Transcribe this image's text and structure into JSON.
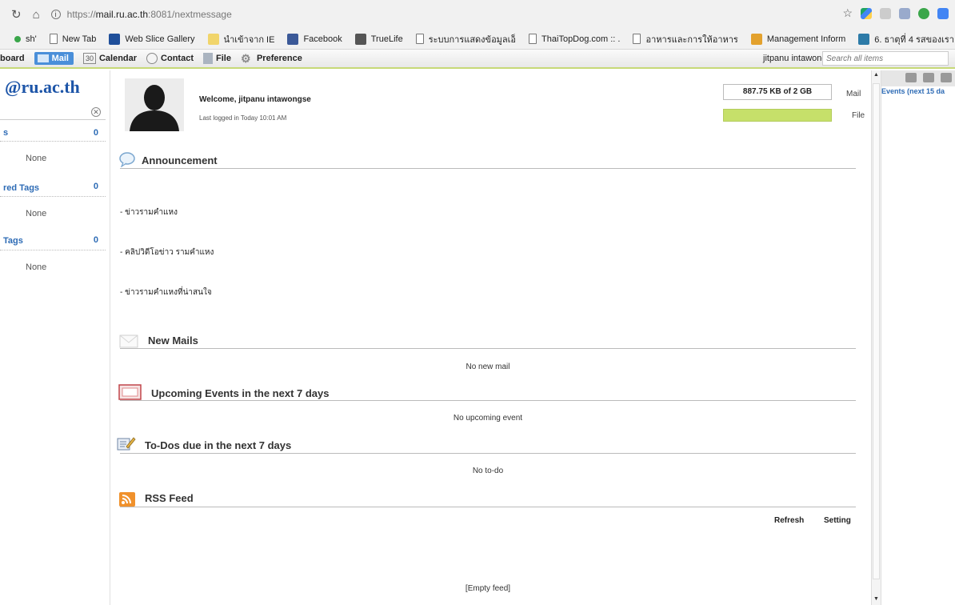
{
  "browser": {
    "url_prefix": "https://",
    "url_host": "mail.ru.ac.th",
    "url_path": ":8081/nextmessage"
  },
  "bookmarks": [
    {
      "label": "sh'",
      "icon": "green-dot-icon",
      "color": "#3aa64a"
    },
    {
      "label": "New Tab",
      "icon": "page-icon"
    },
    {
      "label": "Web Slice Gallery",
      "icon": "web-slice-icon",
      "color": "#1f4f9a"
    },
    {
      "label": "นำเข้าจาก IE",
      "icon": "folder-icon",
      "color": "#f1d56b"
    },
    {
      "label": "Facebook",
      "icon": "facebook-icon",
      "color": "#3b5998"
    },
    {
      "label": "TrueLife",
      "icon": "truelife-icon",
      "color": "#555555"
    },
    {
      "label": "ระบบการแสดงข้อมูลเอ็",
      "icon": "page-icon"
    },
    {
      "label": "ThaiTopDog.com :: .",
      "icon": "page-icon"
    },
    {
      "label": "อาหารและการให้อาหาร",
      "icon": "page-icon"
    },
    {
      "label": "Management Inform",
      "icon": "mis-icon",
      "color": "#e3a12d"
    },
    {
      "label": "6. ธาตุที่ 4 รสของเรา",
      "icon": "wordpress-icon",
      "color": "#2d7ba8"
    }
  ],
  "menubar": {
    "dashboard": "board",
    "mail": "Mail",
    "calendar": "Calendar",
    "calendar_day": "30",
    "contact": "Contact",
    "file": "File",
    "preference": "Preference",
    "user": "jitpanu intawongse",
    "search_placeholder": "Search all items"
  },
  "left": {
    "domain": "@ru.ac.th",
    "groups": [
      {
        "label": "s",
        "count": "0",
        "none": "None"
      },
      {
        "label": "red Tags",
        "count": "0",
        "none": "None"
      },
      {
        "label": "Tags",
        "count": "0",
        "none": "None"
      }
    ]
  },
  "profile": {
    "welcome": "Welcome, jitpanu intawongse",
    "last_logged": "Last logged in Today 10:01 AM",
    "quota": "887.75 KB of 2 GB",
    "mail_label": "Mail",
    "file_label": "File"
  },
  "sections": {
    "announcement": "Announcement",
    "announcement_items": [
      "- ข่าวรามคำแหง",
      "- คลิปวิดีโอข่าว รามคำแหง",
      "- ข่าวรามคำแหงที่น่าสนใจ"
    ],
    "new_mails": "New Mails",
    "new_mails_empty": "No new mail",
    "events": "Upcoming Events in the next 7 days",
    "events_empty": "No upcoming event",
    "todos": "To-Dos due in the next 7 days",
    "todos_empty": "No to-do",
    "rss": "RSS Feed",
    "rss_refresh": "Refresh",
    "rss_setting": "Setting",
    "rss_empty": "[Empty feed]"
  },
  "right": {
    "events_header": "Events (next 15 da"
  }
}
